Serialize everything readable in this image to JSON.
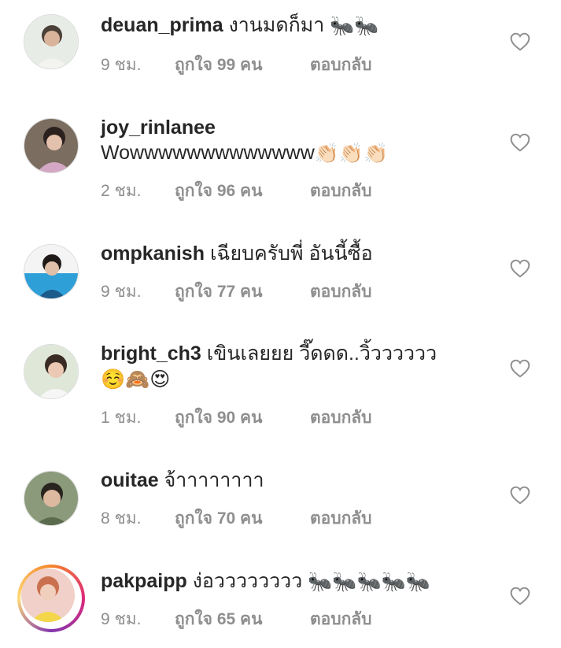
{
  "comments": [
    {
      "username": "deuan_prima",
      "text": "งานมดก็มา",
      "emoji": "🐜🐜",
      "time": "9 ชม.",
      "likes": "ถูกใจ 99 คน",
      "reply": "ตอบกลับ"
    },
    {
      "username": "joy_rinlanee",
      "text": "Wowwwwwwwwwwwww",
      "emoji": "👏🏻👏🏻👏🏻",
      "time": "2 ชม.",
      "likes": "ถูกใจ 96 คน",
      "reply": "ตอบกลับ"
    },
    {
      "username": "ompkanish",
      "text": "เฉียบครับพี่ อันนี้ซื้อ",
      "emoji": "",
      "time": "9 ชม.",
      "likes": "ถูกใจ 77 คน",
      "reply": "ตอบกลับ"
    },
    {
      "username": "bright_ch3",
      "text": "เขินเลยยย วี๊ดดด..วิ้วววววว",
      "emoji": "☺️🙈😍",
      "time": "1 ชม.",
      "likes": "ถูกใจ 90 คน",
      "reply": "ตอบกลับ"
    },
    {
      "username": "ouitae",
      "text": "จ้าาาาาาาา",
      "emoji": "",
      "time": "8 ชม.",
      "likes": "ถูกใจ 70 คน",
      "reply": "ตอบกลับ"
    },
    {
      "username": "pakpaipp",
      "text": "ง่อวววววววว",
      "emoji": "🐜🐜🐜🐜🐜",
      "time": "9 ชม.",
      "likes": "ถูกใจ 65 คน",
      "reply": "ตอบกลับ"
    }
  ]
}
